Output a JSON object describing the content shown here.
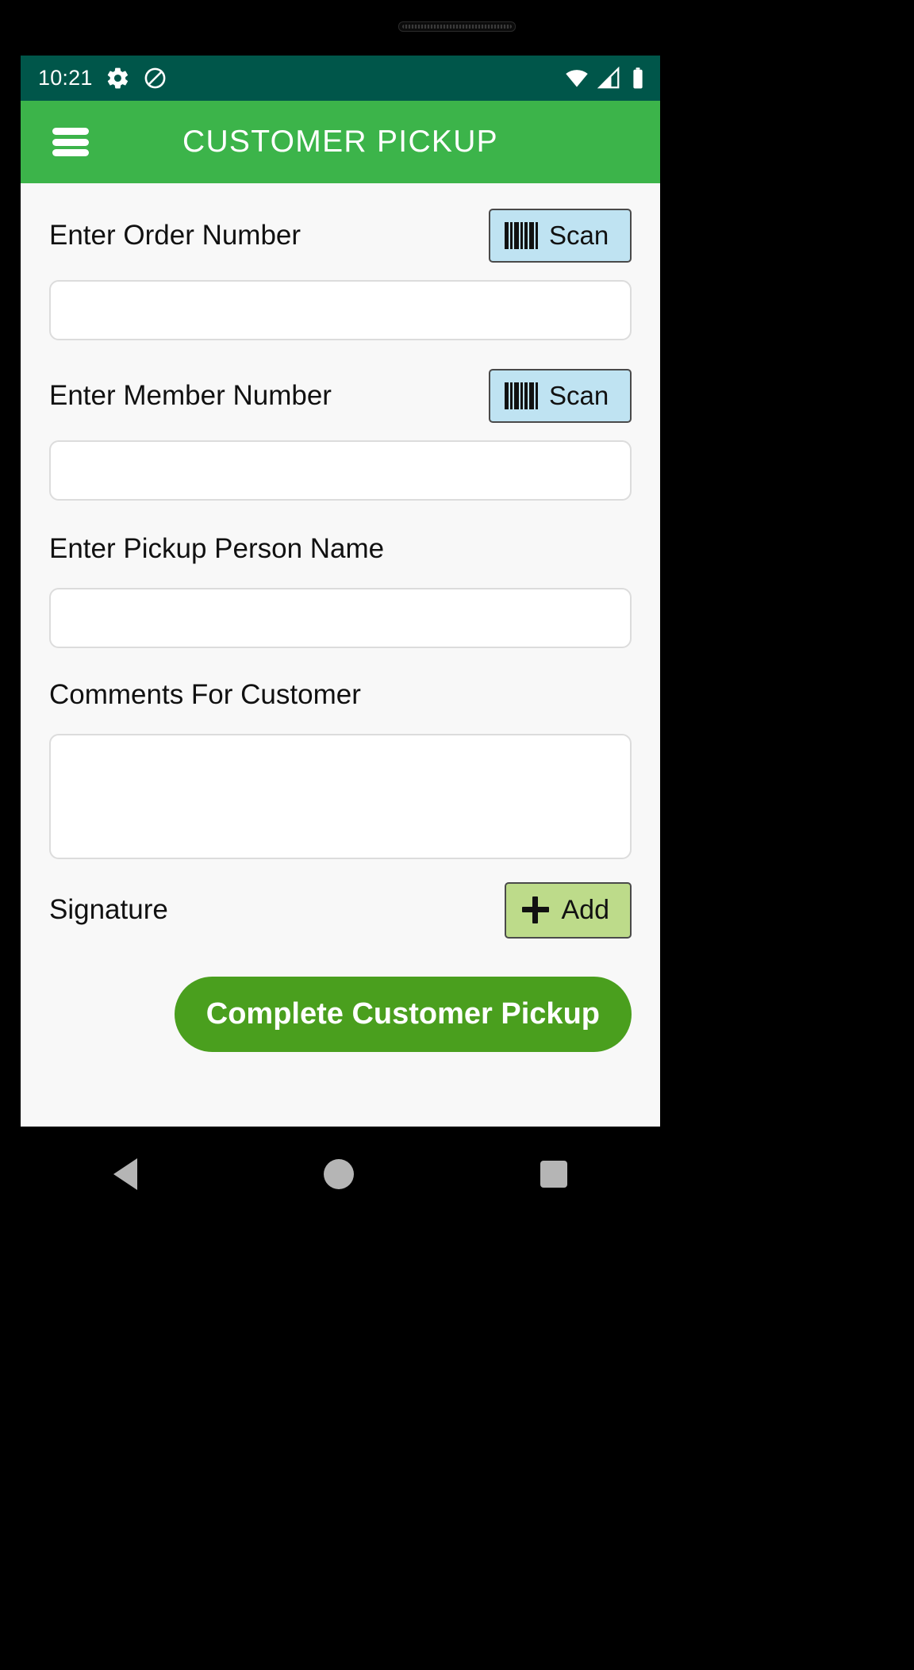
{
  "status_bar": {
    "clock": "10:21",
    "icons_left": [
      "gear-icon",
      "do-not-disturb-icon"
    ],
    "icons_right": [
      "wifi-icon",
      "cell-signal-icon",
      "battery-icon"
    ],
    "background_color": "#00564a"
  },
  "app_bar": {
    "menu_icon": "hamburger-menu-icon",
    "title": "CUSTOMER PICKUP",
    "background_color": "#3cb44a",
    "text_color": "#ffffff"
  },
  "form": {
    "order_number": {
      "label": "Enter Order Number",
      "scan_label": "Scan",
      "scan_icon": "barcode-icon",
      "value": "",
      "placeholder": ""
    },
    "member_number": {
      "label": "Enter Member Number",
      "scan_label": "Scan",
      "scan_icon": "barcode-icon",
      "value": "",
      "placeholder": ""
    },
    "pickup_person": {
      "label": "Enter Pickup Person Name",
      "value": "",
      "placeholder": ""
    },
    "comments": {
      "label": "Comments For Customer",
      "value": "",
      "placeholder": ""
    },
    "signature": {
      "label": "Signature",
      "add_label": "Add",
      "add_icon": "plus-icon"
    }
  },
  "submit": {
    "label": "Complete Customer Pickup",
    "background_color": "#4a9f1e",
    "text_color": "#ffffff"
  },
  "nav_bar": {
    "back_icon": "back-triangle-icon",
    "home_icon": "home-circle-icon",
    "recents_icon": "recents-square-icon"
  }
}
